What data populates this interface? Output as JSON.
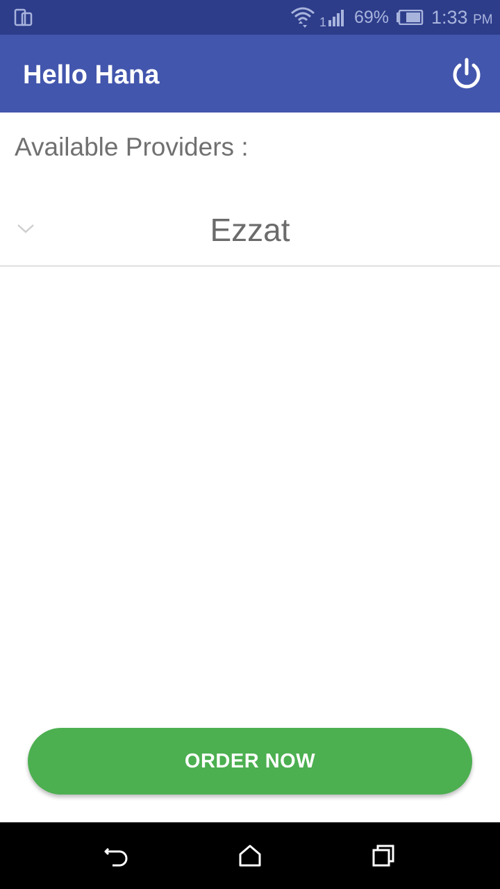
{
  "status_bar": {
    "battery_percent": "69%",
    "time": "1:33",
    "ampm": "PM",
    "signal_label": "1",
    "icons": [
      "screen-mirror-icon",
      "wifi-icon",
      "cell-signal-icon",
      "battery-icon"
    ]
  },
  "app_bar": {
    "title": "Hello Hana",
    "action_icon": "power-icon"
  },
  "content": {
    "providers_label": "Available Providers :",
    "provider_spinner": {
      "selected": "Ezzat",
      "icon": "chevron-down-icon"
    }
  },
  "order_button": {
    "label": "ORDER NOW"
  },
  "nav_bar": {
    "icons": [
      "back-icon",
      "home-icon",
      "recents-icon"
    ]
  },
  "colors": {
    "status_bar": "#2d3d8a",
    "app_bar": "#4356ad",
    "accent_green": "#4caf50",
    "text_gray": "#707070"
  }
}
